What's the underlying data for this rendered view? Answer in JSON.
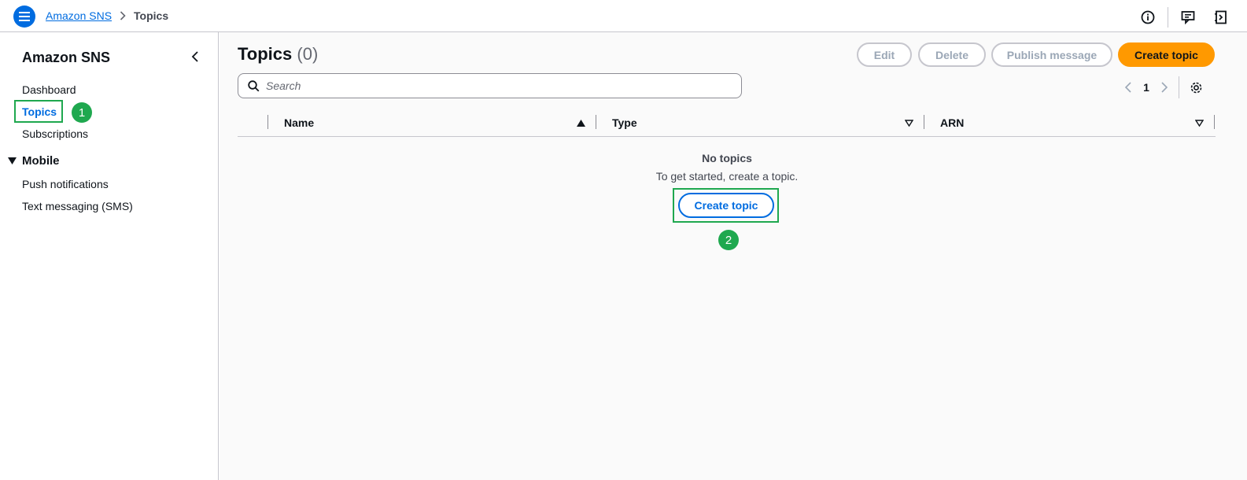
{
  "topbar": {
    "menu_icon": "hamburger-menu-icon",
    "breadcrumb": [
      {
        "label": "Amazon SNS"
      },
      {
        "label": "Topics"
      }
    ],
    "icons": [
      "info-icon",
      "feedback-icon",
      "panel-toggle-icon"
    ]
  },
  "sidebar": {
    "title": "Amazon SNS",
    "items": [
      {
        "label": "Dashboard"
      },
      {
        "label": "Topics"
      },
      {
        "label": "Subscriptions"
      }
    ],
    "section": {
      "label": "Mobile",
      "items": [
        {
          "label": "Push notifications"
        },
        {
          "label": "Text messaging (SMS)"
        }
      ]
    }
  },
  "main": {
    "title": "Topics",
    "count": "(0)",
    "buttons": {
      "edit": "Edit",
      "delete": "Delete",
      "publish": "Publish message",
      "create": "Create topic"
    },
    "search": {
      "placeholder": "Search",
      "value": ""
    },
    "pagination": {
      "current": "1"
    },
    "table": {
      "columns": [
        {
          "label": "Name",
          "sort": "ascending"
        },
        {
          "label": "Type",
          "sort": "none"
        },
        {
          "label": "ARN",
          "sort": "none"
        }
      ]
    },
    "empty_state": {
      "title": "No topics",
      "description": "To get started, create a topic.",
      "button": "Create topic"
    }
  },
  "annotations": [
    {
      "number": "1"
    },
    {
      "number": "2"
    }
  ],
  "colors": {
    "accent": "#006ce0",
    "primary_button": "#ff9900",
    "annotation": "#1fa84f"
  }
}
